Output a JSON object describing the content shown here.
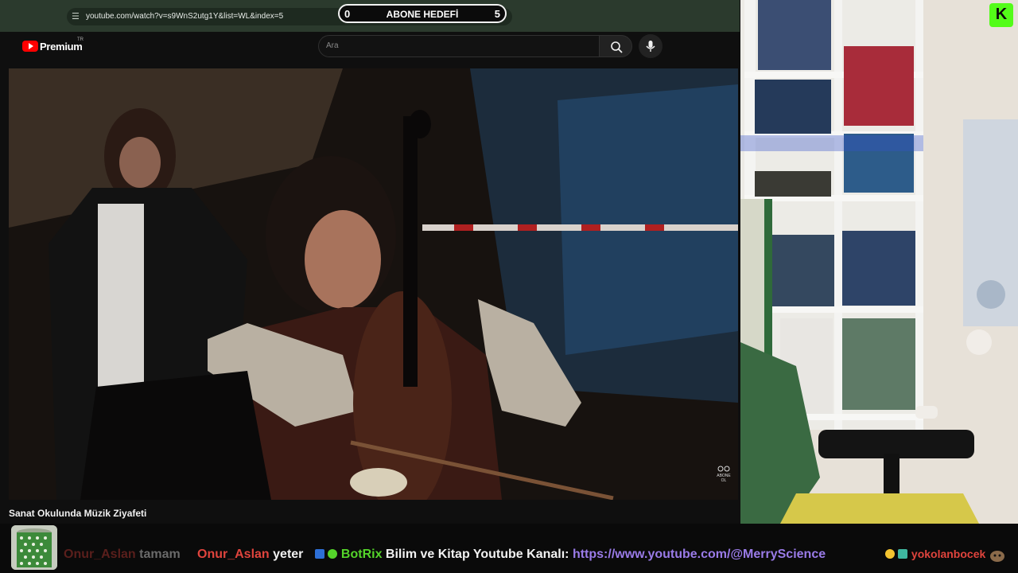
{
  "browser": {
    "url": "youtube.com/watch?v=s9WnS2utg1Y&list=WL&index=5",
    "back_icon": "→",
    "reload_icon": "⟳",
    "home_icon": "⌂",
    "site_info_icon": "☰"
  },
  "goal_widget": {
    "current": "0",
    "title": "ABONE HEDEFİ",
    "target": "5"
  },
  "youtube": {
    "brand": "Premium",
    "region": "TR",
    "search_placeholder": "Ara",
    "video_title": "Sanat Okulunda Müzik Ziyafeti",
    "watermark_label": "ABONE OL"
  },
  "kick": {
    "badge_letter": "K",
    "color": "#53fc18"
  },
  "chat": {
    "messages": [
      {
        "user": "Onur_Aslan",
        "text": "tamam",
        "faded": true
      },
      {
        "user": "Onur_Aslan",
        "text": "yeter",
        "faded": false
      },
      {
        "user": "BotRix",
        "text": "Bilim ve Kitap Youtube Kanalı:",
        "link": "https://www.youtube.com/@MerryScience",
        "is_bot": true
      },
      {
        "user": "yokolanbocek",
        "text": "",
        "faded": false
      }
    ]
  },
  "colors": {
    "browser_bar": "#2b3a2d",
    "yt_red": "#ff0000",
    "username_red": "#e0443d",
    "bot_green": "#54d42a",
    "link_purple": "#9a7be8"
  }
}
